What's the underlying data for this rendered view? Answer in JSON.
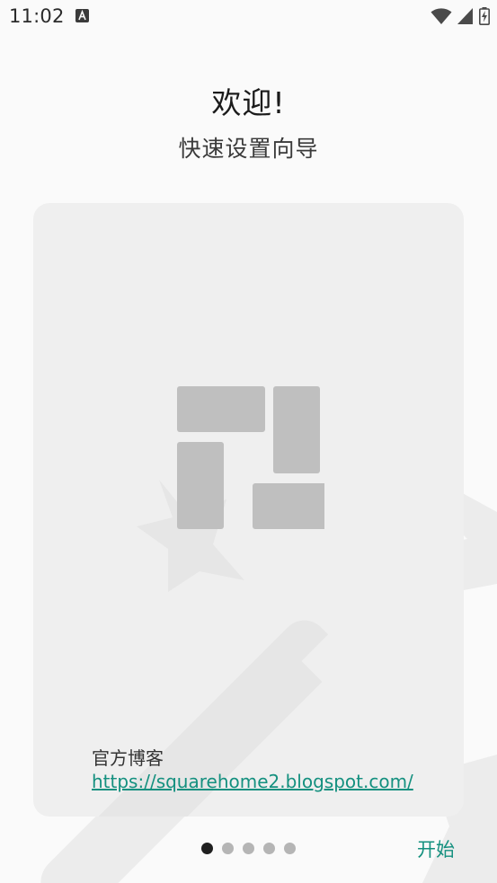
{
  "status_bar": {
    "time": "11:02",
    "notification_icon": "text-a-icon",
    "icons": [
      "wifi-icon",
      "cellular-signal-icon",
      "battery-charging-icon"
    ]
  },
  "header": {
    "title": "欢迎!",
    "subtitle": "快速设置向导"
  },
  "card": {
    "logo_icon": "squarehome-logo-icon",
    "blog_label": "官方博客",
    "blog_link": "https://squarehome2.blogspot.com/"
  },
  "pager": {
    "page_count": 5,
    "current_page": 1
  },
  "footer": {
    "start_label": "开始"
  },
  "colors": {
    "accent": "#14907f",
    "background": "#fafafa",
    "card": "#efefef",
    "tile": "#bfbfbf",
    "dot_active": "#1f1f1f",
    "dot_inactive": "#b5b5b5"
  }
}
